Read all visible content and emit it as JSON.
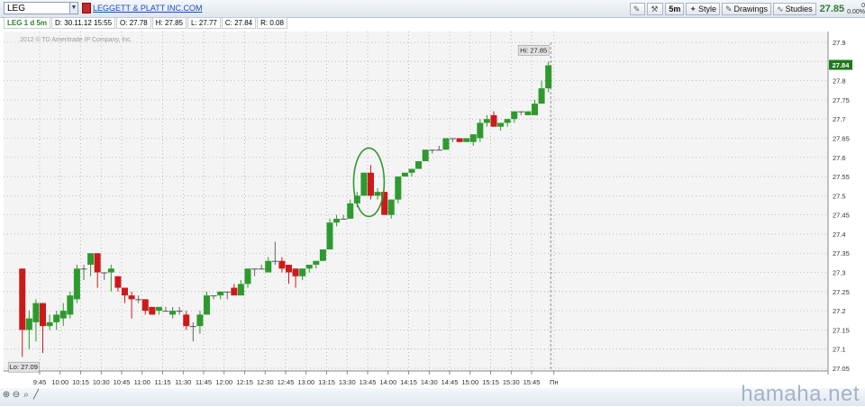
{
  "header": {
    "symbol": "LEG",
    "company": "LEGGETT & PLATT INC.COM",
    "tools": {
      "interval": "5m",
      "style": "Style",
      "drawings": "Drawings",
      "studies": "Studies"
    },
    "last_price": "27.85",
    "change_top": "0",
    "change_bottom": "0.00%"
  },
  "info_bar": {
    "tag": "LEG 1 d 5m",
    "date": "D: 30.11.12 15:55",
    "open": "O: 27.78",
    "high": "H: 27.85",
    "low": "L: 27.77",
    "close": "C: 27.84",
    "range": "R: 0.08"
  },
  "copyright": "2012 © TD Ameritrade IP Company, Inc.",
  "watermark": "hamaha.net",
  "colors": {
    "up": "#2e9a2e",
    "down": "#cc1a1a",
    "flat": "#555555",
    "grid": "#b0b0b0",
    "last_badge": "#1f7a1f",
    "ellipse": "#2e9a2e"
  },
  "chart_data": {
    "type": "candlestick",
    "ylim": [
      27.05,
      27.92
    ],
    "y_ticks": [
      "27.9",
      "27.85",
      "27.8",
      "27.75",
      "27.7",
      "27.65",
      "27.6",
      "27.55",
      "27.5",
      "27.45",
      "27.4",
      "27.35",
      "27.3",
      "27.25",
      "27.2",
      "27.15",
      "27.1",
      "27.05"
    ],
    "x_ticks": [
      "9:45",
      "10:00",
      "10:15",
      "10:30",
      "10:45",
      "11:00",
      "11:15",
      "11:30",
      "11:45",
      "12:00",
      "12:15",
      "12:30",
      "12:45",
      "13:00",
      "13:15",
      "13:30",
      "13:45",
      "14:00",
      "14:15",
      "14:30",
      "14:45",
      "15:00",
      "15:15",
      "15:30",
      "15:45",
      "Пн"
    ],
    "bar_width_minutes": 5,
    "candles": [
      {
        "t": "9:30",
        "o": 27.31,
        "h": 27.31,
        "l": 27.08,
        "c": 27.15
      },
      {
        "t": "9:35",
        "o": 27.15,
        "h": 27.2,
        "l": 27.1,
        "c": 27.18
      },
      {
        "t": "9:40",
        "o": 27.17,
        "h": 27.23,
        "l": 27.12,
        "c": 27.22
      },
      {
        "t": "9:45",
        "o": 27.22,
        "h": 27.22,
        "l": 27.09,
        "c": 27.16
      },
      {
        "t": "9:50",
        "o": 27.16,
        "h": 27.19,
        "l": 27.15,
        "c": 27.17
      },
      {
        "t": "9:55",
        "o": 27.17,
        "h": 27.2,
        "l": 27.15,
        "c": 27.19
      },
      {
        "t": "10:00",
        "o": 27.18,
        "h": 27.22,
        "l": 27.16,
        "c": 27.2
      },
      {
        "t": "10:05",
        "o": 27.19,
        "h": 27.25,
        "l": 27.18,
        "c": 27.24
      },
      {
        "t": "10:10",
        "o": 27.23,
        "h": 27.32,
        "l": 27.22,
        "c": 27.31
      },
      {
        "t": "10:15",
        "o": 27.31,
        "h": 27.32,
        "l": 27.28,
        "c": 27.31
      },
      {
        "t": "10:20",
        "o": 27.32,
        "h": 27.35,
        "l": 27.29,
        "c": 27.35
      },
      {
        "t": "10:25",
        "o": 27.35,
        "h": 27.35,
        "l": 27.26,
        "c": 27.3
      },
      {
        "t": "10:30",
        "o": 27.3,
        "h": 27.3,
        "l": 27.28,
        "c": 27.3
      },
      {
        "t": "10:35",
        "o": 27.3,
        "h": 27.32,
        "l": 27.25,
        "c": 27.31
      },
      {
        "t": "10:40",
        "o": 27.29,
        "h": 27.29,
        "l": 27.25,
        "c": 27.26
      },
      {
        "t": "10:45",
        "o": 27.26,
        "h": 27.26,
        "l": 27.22,
        "c": 27.24
      },
      {
        "t": "10:50",
        "o": 27.24,
        "h": 27.25,
        "l": 27.18,
        "c": 27.23
      },
      {
        "t": "10:55",
        "o": 27.23,
        "h": 27.24,
        "l": 27.22,
        "c": 27.23
      },
      {
        "t": "11:00",
        "o": 27.23,
        "h": 27.23,
        "l": 27.19,
        "c": 27.2
      },
      {
        "t": "11:05",
        "o": 27.21,
        "h": 27.21,
        "l": 27.19,
        "c": 27.19
      },
      {
        "t": "11:10",
        "o": 27.2,
        "h": 27.21,
        "l": 27.19,
        "c": 27.21
      },
      {
        "t": "11:15",
        "o": 27.2,
        "h": 27.21,
        "l": 27.2,
        "c": 27.2
      },
      {
        "t": "11:20",
        "o": 27.19,
        "h": 27.21,
        "l": 27.18,
        "c": 27.2
      },
      {
        "t": "11:25",
        "o": 27.2,
        "h": 27.21,
        "l": 27.19,
        "c": 27.2
      },
      {
        "t": "11:30",
        "o": 27.19,
        "h": 27.2,
        "l": 27.15,
        "c": 27.16
      },
      {
        "t": "11:35",
        "o": 27.16,
        "h": 27.17,
        "l": 27.12,
        "c": 27.16
      },
      {
        "t": "11:40",
        "o": 27.16,
        "h": 27.2,
        "l": 27.14,
        "c": 27.19
      },
      {
        "t": "11:45",
        "o": 27.19,
        "h": 27.25,
        "l": 27.19,
        "c": 27.24
      },
      {
        "t": "11:50",
        "o": 27.24,
        "h": 27.24,
        "l": 27.23,
        "c": 27.24
      },
      {
        "t": "11:55",
        "o": 27.24,
        "h": 27.25,
        "l": 27.23,
        "c": 27.25
      },
      {
        "t": "12:00",
        "o": 27.25,
        "h": 27.25,
        "l": 27.23,
        "c": 27.25
      },
      {
        "t": "12:05",
        "o": 27.26,
        "h": 27.27,
        "l": 27.24,
        "c": 27.24
      },
      {
        "t": "12:10",
        "o": 27.24,
        "h": 27.28,
        "l": 27.24,
        "c": 27.27
      },
      {
        "t": "12:15",
        "o": 27.27,
        "h": 27.31,
        "l": 27.26,
        "c": 27.31
      },
      {
        "t": "12:20",
        "o": 27.31,
        "h": 27.31,
        "l": 27.29,
        "c": 27.31
      },
      {
        "t": "12:25",
        "o": 27.31,
        "h": 27.32,
        "l": 27.31,
        "c": 27.31
      },
      {
        "t": "12:30",
        "o": 27.3,
        "h": 27.34,
        "l": 27.3,
        "c": 27.33
      },
      {
        "t": "12:35",
        "o": 27.33,
        "h": 27.38,
        "l": 27.32,
        "c": 27.33
      },
      {
        "t": "12:40",
        "o": 27.33,
        "h": 27.34,
        "l": 27.3,
        "c": 27.31
      },
      {
        "t": "12:45",
        "o": 27.32,
        "h": 27.32,
        "l": 27.27,
        "c": 27.3
      },
      {
        "t": "12:50",
        "o": 27.31,
        "h": 27.31,
        "l": 27.26,
        "c": 27.29
      },
      {
        "t": "12:55",
        "o": 27.29,
        "h": 27.31,
        "l": 27.28,
        "c": 27.31
      },
      {
        "t": "13:00",
        "o": 27.31,
        "h": 27.32,
        "l": 27.3,
        "c": 27.32
      },
      {
        "t": "13:05",
        "o": 27.32,
        "h": 27.33,
        "l": 27.31,
        "c": 27.33
      },
      {
        "t": "13:10",
        "o": 27.33,
        "h": 27.36,
        "l": 27.33,
        "c": 27.36
      },
      {
        "t": "13:15",
        "o": 27.36,
        "h": 27.44,
        "l": 27.36,
        "c": 27.43
      },
      {
        "t": "13:20",
        "o": 27.43,
        "h": 27.45,
        "l": 27.42,
        "c": 27.44
      },
      {
        "t": "13:25",
        "o": 27.44,
        "h": 27.45,
        "l": 27.44,
        "c": 27.44
      },
      {
        "t": "13:30",
        "o": 27.44,
        "h": 27.49,
        "l": 27.44,
        "c": 27.48
      },
      {
        "t": "13:35",
        "o": 27.48,
        "h": 27.51,
        "l": 27.47,
        "c": 27.5
      },
      {
        "t": "13:40",
        "o": 27.5,
        "h": 27.56,
        "l": 27.5,
        "c": 27.56
      },
      {
        "t": "13:45",
        "o": 27.56,
        "h": 27.58,
        "l": 27.49,
        "c": 27.5
      },
      {
        "t": "13:50",
        "o": 27.5,
        "h": 27.52,
        "l": 27.49,
        "c": 27.51
      },
      {
        "t": "13:55",
        "o": 27.51,
        "h": 27.51,
        "l": 27.45,
        "c": 27.45
      },
      {
        "t": "14:00",
        "o": 27.45,
        "h": 27.49,
        "l": 27.44,
        "c": 27.49
      },
      {
        "t": "14:05",
        "o": 27.49,
        "h": 27.55,
        "l": 27.48,
        "c": 27.55
      },
      {
        "t": "14:10",
        "o": 27.55,
        "h": 27.56,
        "l": 27.55,
        "c": 27.56
      },
      {
        "t": "14:15",
        "o": 27.56,
        "h": 27.57,
        "l": 27.55,
        "c": 27.57
      },
      {
        "t": "14:20",
        "o": 27.57,
        "h": 27.59,
        "l": 27.57,
        "c": 27.59
      },
      {
        "t": "14:25",
        "o": 27.59,
        "h": 27.62,
        "l": 27.59,
        "c": 27.62
      },
      {
        "t": "14:30",
        "o": 27.62,
        "h": 27.62,
        "l": 27.61,
        "c": 27.62
      },
      {
        "t": "14:35",
        "o": 27.62,
        "h": 27.63,
        "l": 27.62,
        "c": 27.62
      },
      {
        "t": "14:40",
        "o": 27.62,
        "h": 27.65,
        "l": 27.62,
        "c": 27.65
      },
      {
        "t": "14:45",
        "o": 27.65,
        "h": 27.65,
        "l": 27.64,
        "c": 27.65
      },
      {
        "t": "14:50",
        "o": 27.65,
        "h": 27.65,
        "l": 27.64,
        "c": 27.64
      },
      {
        "t": "14:55",
        "o": 27.64,
        "h": 27.65,
        "l": 27.64,
        "c": 27.65
      },
      {
        "t": "15:00",
        "o": 27.64,
        "h": 27.66,
        "l": 27.63,
        "c": 27.66
      },
      {
        "t": "15:05",
        "o": 27.65,
        "h": 27.7,
        "l": 27.64,
        "c": 27.69
      },
      {
        "t": "15:10",
        "o": 27.69,
        "h": 27.71,
        "l": 27.68,
        "c": 27.7
      },
      {
        "t": "15:15",
        "o": 27.71,
        "h": 27.72,
        "l": 27.68,
        "c": 27.68
      },
      {
        "t": "15:20",
        "o": 27.68,
        "h": 27.69,
        "l": 27.67,
        "c": 27.69
      },
      {
        "t": "15:25",
        "o": 27.69,
        "h": 27.7,
        "l": 27.68,
        "c": 27.7
      },
      {
        "t": "15:30",
        "o": 27.7,
        "h": 27.72,
        "l": 27.69,
        "c": 27.72
      },
      {
        "t": "15:35",
        "o": 27.72,
        "h": 27.72,
        "l": 27.71,
        "c": 27.72
      },
      {
        "t": "15:40",
        "o": 27.71,
        "h": 27.72,
        "l": 27.71,
        "c": 27.72
      },
      {
        "t": "15:45",
        "o": 27.71,
        "h": 27.75,
        "l": 27.71,
        "c": 27.74
      },
      {
        "t": "15:50",
        "o": 27.74,
        "h": 27.8,
        "l": 27.74,
        "c": 27.78
      },
      {
        "t": "15:55",
        "o": 27.78,
        "h": 27.85,
        "l": 27.77,
        "c": 27.84
      }
    ],
    "annotations": {
      "hi_label": "Hi: 27.85",
      "lo_label": "Lo: 27.09",
      "last_label": "27.84"
    }
  }
}
